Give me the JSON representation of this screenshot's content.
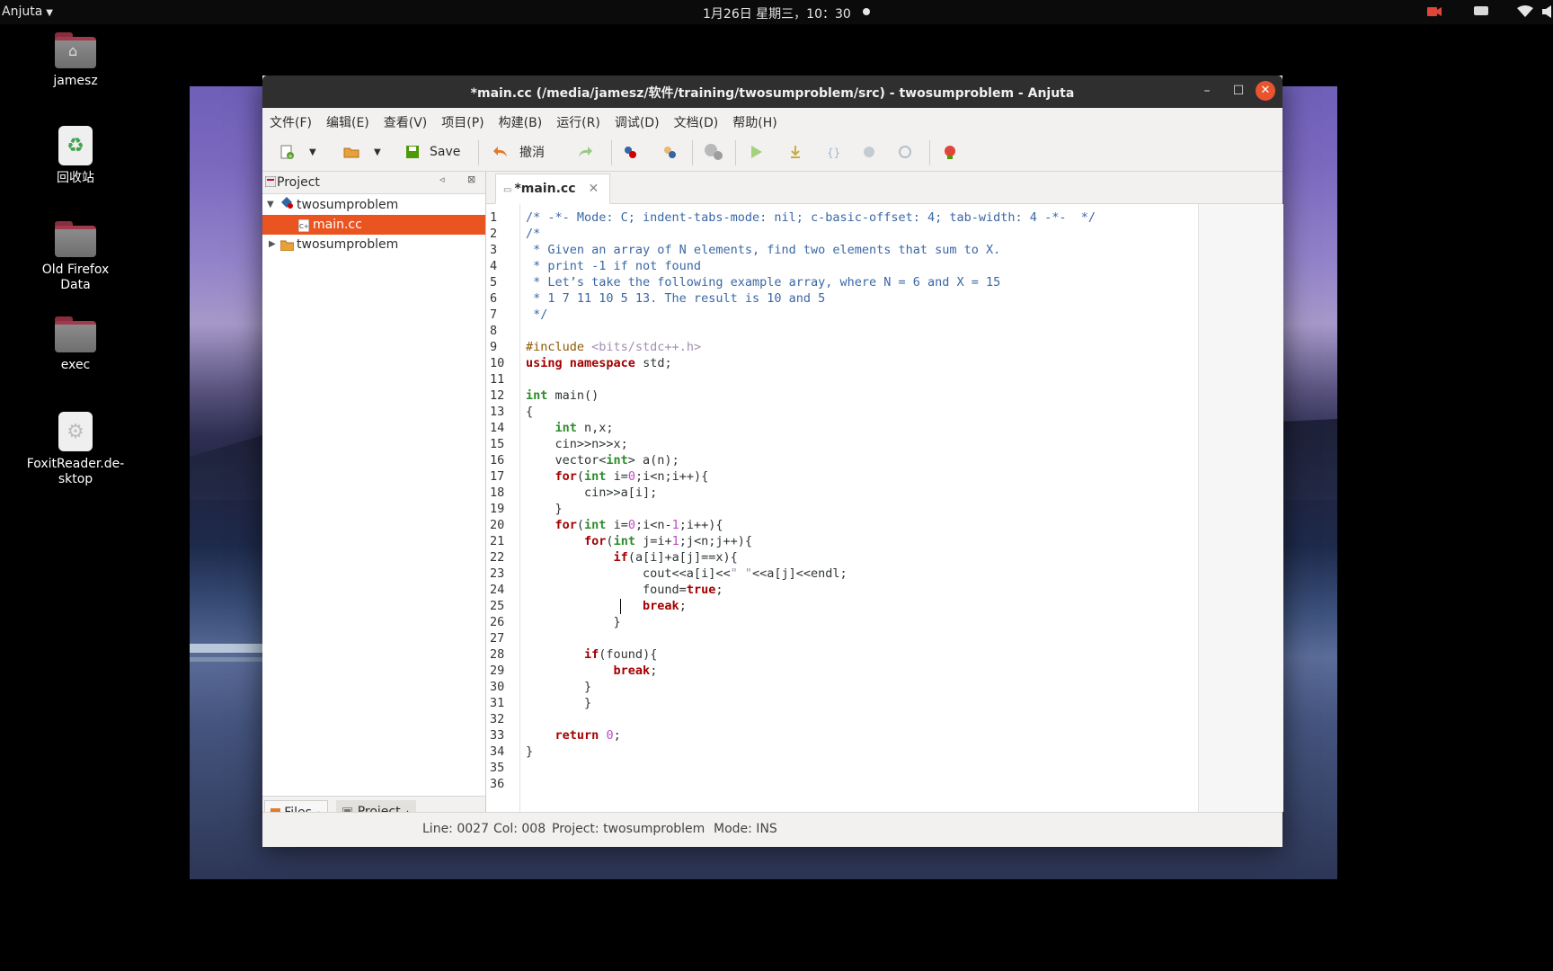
{
  "topbar": {
    "app_menu": "Anjuta",
    "clock": "1月26日 星期三，10：30"
  },
  "desktop": {
    "icons": [
      {
        "label": "jamesz"
      },
      {
        "label": "回收站"
      },
      {
        "label": "Old Firefox\nData"
      },
      {
        "label": "exec"
      },
      {
        "label": "FoxitReader.de-\nsktop"
      }
    ]
  },
  "window": {
    "title": "*main.cc (/media/jamesz/软件/training/twosumproblem/src) - twosumproblem - Anjuta",
    "menu": [
      "文件(F)",
      "编辑(E)",
      "查看(V)",
      "项目(P)",
      "构建(B)",
      "运行(R)",
      "调试(D)",
      "文档(D)",
      "帮助(H)"
    ],
    "toolbar": {
      "save_label": "Save",
      "undo_label": "撤消"
    },
    "left_panel": {
      "title": "Project",
      "tree": [
        {
          "label": "twosumproblem",
          "expanded": true
        },
        {
          "label": "main.cc",
          "selected": true
        },
        {
          "label": "twosumproblem",
          "expanded": false
        }
      ],
      "tabs": [
        {
          "label": "Files",
          "active": true
        },
        {
          "label": "Project",
          "active": false
        }
      ]
    },
    "editor": {
      "tab_label": "*main.cc",
      "lines": [
        "/* -*- Mode: C; indent-tabs-mode: nil; c-basic-offset: 4; tab-width: 4 -*-  */",
        "/*",
        " * Given an array of N elements, find two elements that sum to X.",
        " * print -1 if not found",
        " * Let’s take the following example array, where N = 6 and X = 15",
        " * 1 7 11 10 5 13. The result is 10 and 5",
        " */",
        "",
        "#include <bits/stdc++.h>",
        "using namespace std;",
        "",
        "int main()",
        "{",
        "    int n,x;",
        "    cin>>n>>x;",
        "    vector<int> a(n);",
        "    for(int i=0;i<n;i++){",
        "        cin>>a[i];",
        "    }",
        "    for(int i=0;i<n-1;i++){",
        "        for(int j=i+1;j<n;j++){",
        "            if(a[i]+a[j]==x){",
        "                cout<<a[i]<<\" \"<<a[j]<<endl;",
        "                found=true;",
        "                break;",
        "            }",
        "        ",
        "        if(found){",
        "            break;",
        "        }",
        "        }",
        "",
        "    return 0;",
        "}",
        "",
        ""
      ]
    },
    "status": {
      "line": "Line: 0027",
      "col": "Col: 008",
      "project": "Project: twosumproblem",
      "mode": "Mode: INS"
    }
  },
  "colors": {
    "accent": "#e95420",
    "titlebar": "#2f2f2f",
    "comment": "#3a67a6",
    "keyword": "#a40000",
    "type": "#2e8b2e",
    "number": "#c04ac0"
  }
}
